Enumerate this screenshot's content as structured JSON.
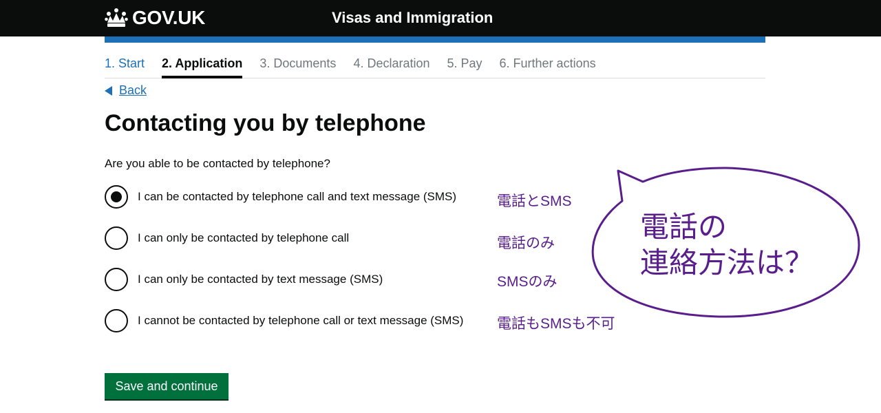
{
  "header": {
    "brand": "GOV.UK",
    "crown_icon": "crown-icon",
    "service_name": "Visas and Immigration"
  },
  "colors": {
    "header_bg": "#0b0c0c",
    "accent_blue": "#1d70b8",
    "button_green": "#00703c",
    "annotation_purple": "#5a1e8c"
  },
  "steps": [
    {
      "label": "1. Start",
      "state": "done"
    },
    {
      "label": "2. Application",
      "state": "current"
    },
    {
      "label": "3. Documents",
      "state": "upcoming"
    },
    {
      "label": "4. Declaration",
      "state": "upcoming"
    },
    {
      "label": "5. Pay",
      "state": "upcoming"
    },
    {
      "label": "6. Further actions",
      "state": "upcoming"
    }
  ],
  "back_link": "Back",
  "page_title": "Contacting you by telephone",
  "question": "Are you able to be contacted by telephone?",
  "options": [
    {
      "label": "I can be contacted by telephone call and text message (SMS)",
      "note": "電話とSMS",
      "checked": true
    },
    {
      "label": "I can only be contacted by telephone call",
      "note": "電話のみ",
      "checked": false
    },
    {
      "label": "I can only be contacted by text message (SMS)",
      "note": "SMSのみ",
      "checked": false
    },
    {
      "label": "I cannot be contacted by telephone call or text message (SMS)",
      "note": "電話もSMSも不可",
      "checked": false
    }
  ],
  "save_button": "Save and continue",
  "speech_bubble": {
    "line1": "電話の",
    "line2": "連絡方法は？"
  }
}
